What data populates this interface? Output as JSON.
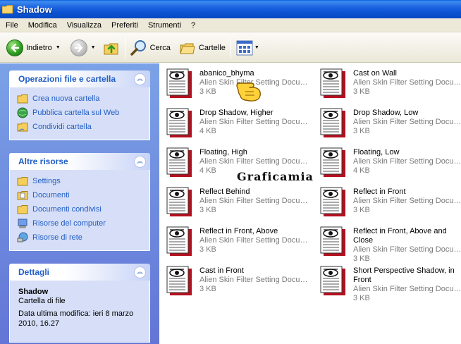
{
  "window": {
    "title": "Shadow"
  },
  "menu": [
    "File",
    "Modifica",
    "Visualizza",
    "Preferiti",
    "Strumenti",
    "?"
  ],
  "toolbar": {
    "back_label": "Indietro",
    "search_label": "Cerca",
    "folders_label": "Cartelle"
  },
  "tasks": {
    "file_ops": {
      "title": "Operazioni file e cartella",
      "links": [
        "Crea nuova cartella",
        "Pubblica cartella sul Web",
        "Condividi cartella"
      ]
    },
    "other_places": {
      "title": "Altre risorse",
      "links": [
        "Settings",
        "Documenti",
        "Documenti condivisi",
        "Risorse del computer",
        "Risorse di rete"
      ]
    },
    "details": {
      "title": "Dettagli",
      "name": "Shadow",
      "type": "Cartella di file",
      "modified_line1": "Data ultima modifica: ieri 8 marzo",
      "modified_line2": "2010, 16.27"
    }
  },
  "files": [
    {
      "name": "abanico_bhyma",
      "type": "Alien Skin Filter Setting Docum...",
      "size": "3 KB"
    },
    {
      "name": "Cast on Wall",
      "type": "Alien Skin Filter Setting Docum...",
      "size": "3 KB"
    },
    {
      "name": "Drop Shadow, Higher",
      "type": "Alien Skin Filter Setting Docum...",
      "size": "4 KB"
    },
    {
      "name": "Drop Shadow, Low",
      "type": "Alien Skin Filter Setting Docum...",
      "size": "3 KB"
    },
    {
      "name": "Floating, High",
      "type": "Alien Skin Filter Setting Docum...",
      "size": "4 KB"
    },
    {
      "name": "Floating, Low",
      "type": "Alien Skin Filter Setting Docum...",
      "size": "4 KB"
    },
    {
      "name": "Reflect Behind",
      "type": "Alien Skin Filter Setting Docum...",
      "size": "3 KB"
    },
    {
      "name": "Reflect in Front",
      "type": "Alien Skin Filter Setting Docum...",
      "size": "3 KB"
    },
    {
      "name": "Reflect in Front, Above",
      "type": "Alien Skin Filter Setting Docum...",
      "size": "3 KB"
    },
    {
      "name": "Reflect in Front, Above and Close",
      "type": "Alien Skin Filter Setting Docum...",
      "size": "3 KB"
    },
    {
      "name": "Cast in Front",
      "type": "Alien Skin Filter Setting Docum...",
      "size": "3 KB"
    },
    {
      "name": "Short Perspective Shadow, in Front",
      "type": "Alien Skin Filter Setting Docum...",
      "size": "3 KB"
    }
  ],
  "watermark": "Graficamia"
}
